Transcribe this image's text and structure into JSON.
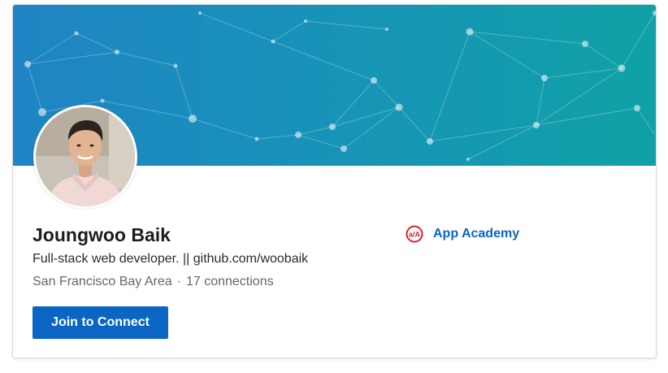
{
  "profile": {
    "name": "Joungwoo Baik",
    "headline": "Full-stack web developer. || github.com/woobaik",
    "location": "San Francisco Bay Area",
    "separator": "·",
    "connections": "17 connections"
  },
  "actions": {
    "join_label": "Join to Connect"
  },
  "company": {
    "name": "App Academy",
    "logo_text": "a/A",
    "logo_icon": "app-academy-logo-icon"
  },
  "colors": {
    "banner_start": "#1f84c4",
    "banner_end": "#10a1a6",
    "primary": "#0a66c2",
    "logo_red": "#e0202b"
  }
}
